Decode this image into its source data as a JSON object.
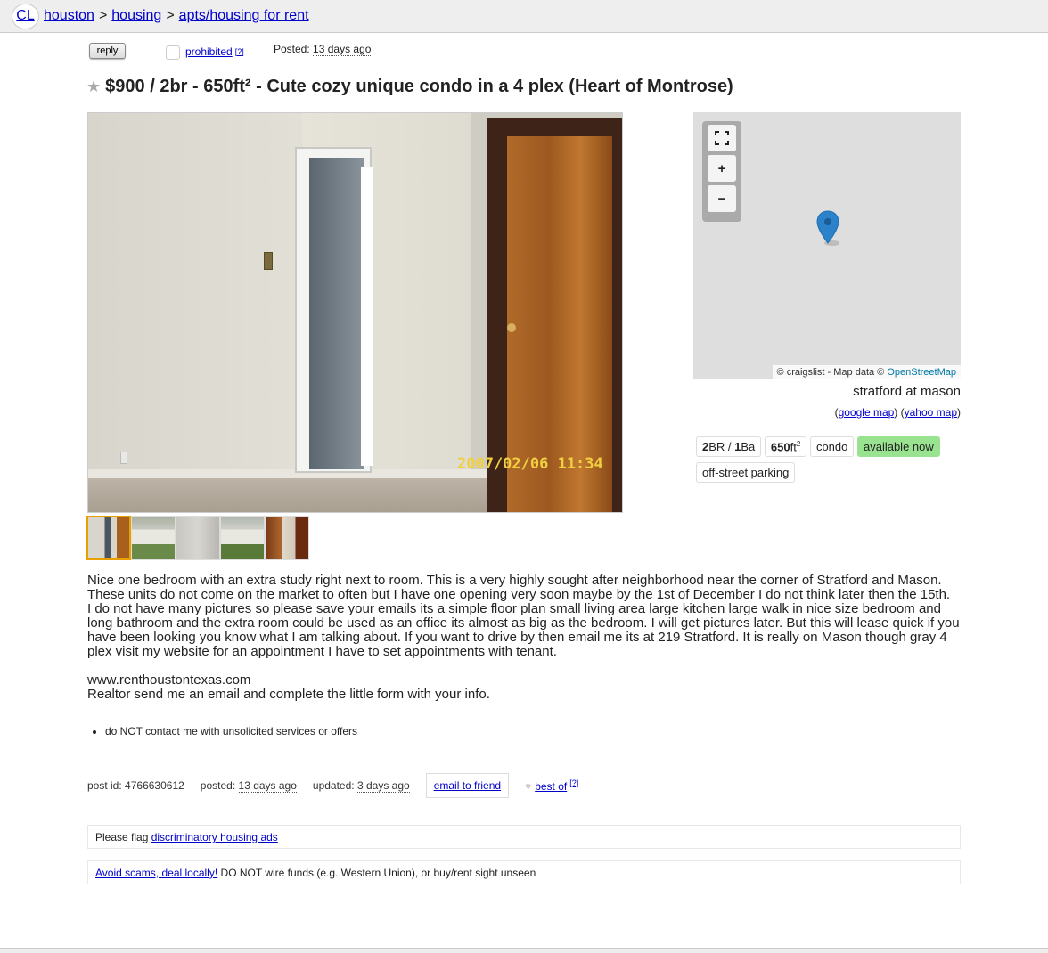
{
  "breadcrumb": {
    "logo": "CL",
    "items": [
      "houston",
      "housing",
      "apts/housing for rent"
    ],
    "separator": ">"
  },
  "infoline": {
    "reply": "reply",
    "prohibited": "prohibited",
    "help": "[?]",
    "posted_label": "Posted:",
    "posted_value": "13 days ago"
  },
  "title": {
    "price": "$900",
    "housing": "/ 2br - 650ft²",
    "text": "- Cute cozy unique condo in a 4 plex (Heart of Montrose)"
  },
  "photo": {
    "timestamp": "2007/02/06 11:34",
    "thumb_count": 5
  },
  "map": {
    "attribution_prefix": "© craigslist - Map data ©",
    "attribution_link": "OpenStreetMap",
    "address": "stratford at mason",
    "google": "google map",
    "yahoo": "yahoo map"
  },
  "attributes": {
    "br": "2",
    "br_label": "BR /",
    "ba": "1",
    "ba_label": "Ba",
    "sqft": "650",
    "sqft_unit": "ft",
    "sqft_sup": "2",
    "type": "condo",
    "availability": "available now",
    "parking": "off-street parking"
  },
  "body": {
    "p1": "Nice one bedroom with an extra study right next to room. This is a very highly sought after neighborhood near the corner of Stratford and Mason. These units do not come on the market to often but I have one opening very soon maybe by the 1st of December I do not think later then the 15th.",
    "p2": "I do not have many pictures so please save your emails its a simple floor plan small living area large kitchen large walk in nice size bedroom and long bathroom and the extra room could be used as an office its almost as big as the bedroom. I will get pictures later. But this will lease quick if you have been looking you know what I am talking about. If you want to drive by then email me its at 219 Stratford. It is really on Mason though gray 4 plex visit my website for an appointment I have to set appointments with tenant.",
    "p3": "www.renthoustontexas.com",
    "p4": "Realtor send me an email and complete the little form with your info."
  },
  "notices": [
    "do NOT contact me with unsolicited services or offers"
  ],
  "footer": {
    "postid_label": "post id:",
    "postid": "4766630612",
    "posted_label": "posted:",
    "posted": "13 days ago",
    "updated_label": "updated:",
    "updated": "3 days ago",
    "email": "email to friend",
    "bestof": "best of",
    "help": "[?]"
  },
  "flag": {
    "prefix": "Please flag",
    "link": "discriminatory housing ads"
  },
  "scam": {
    "link": "Avoid scams, deal locally!",
    "text": "DO NOT wire funds (e.g. Western Union), or buy/rent sight unseen"
  }
}
